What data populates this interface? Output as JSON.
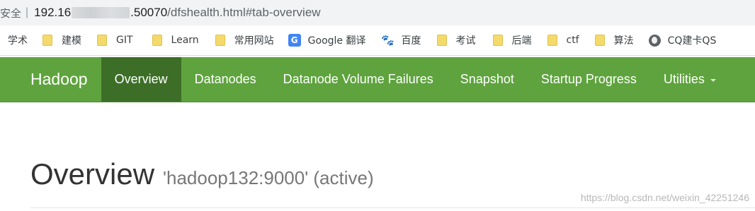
{
  "address_bar": {
    "security_label": "安全",
    "url_host_visible": "192.16",
    "url_port_visible": ".50070",
    "url_path": "/dfshealth.html#tab-overview"
  },
  "bookmarks": [
    {
      "label": "学术",
      "icon": "none"
    },
    {
      "label": "建模",
      "icon": "folder-icon"
    },
    {
      "label": "GIT",
      "icon": "folder-icon"
    },
    {
      "label": "Learn",
      "icon": "folder-icon"
    },
    {
      "label": "常用网站",
      "icon": "folder-icon"
    },
    {
      "label": "Google 翻译",
      "icon": "google-translate-icon"
    },
    {
      "label": "百度",
      "icon": "baidu-paw-icon"
    },
    {
      "label": "考试",
      "icon": "folder-icon"
    },
    {
      "label": "后端",
      "icon": "folder-icon"
    },
    {
      "label": "ctf",
      "icon": "folder-icon"
    },
    {
      "label": "算法",
      "icon": "folder-icon"
    },
    {
      "label": "CQ建卡QS",
      "icon": "globe-icon"
    }
  ],
  "navbar": {
    "brand": "Hadoop",
    "items": [
      {
        "label": "Overview",
        "active": true
      },
      {
        "label": "Datanodes",
        "active": false
      },
      {
        "label": "Datanode Volume Failures",
        "active": false
      },
      {
        "label": "Snapshot",
        "active": false
      },
      {
        "label": "Startup Progress",
        "active": false
      },
      {
        "label": "Utilities",
        "active": false,
        "dropdown": true
      }
    ],
    "colors": {
      "background": "#5fa33e",
      "active_background": "#3d6e28",
      "text": "#ffffff"
    }
  },
  "page": {
    "title": "Overview",
    "subtitle": "'hadoop132:9000' (active)"
  },
  "watermark": "https://blog.csdn.net/weixin_42251246"
}
